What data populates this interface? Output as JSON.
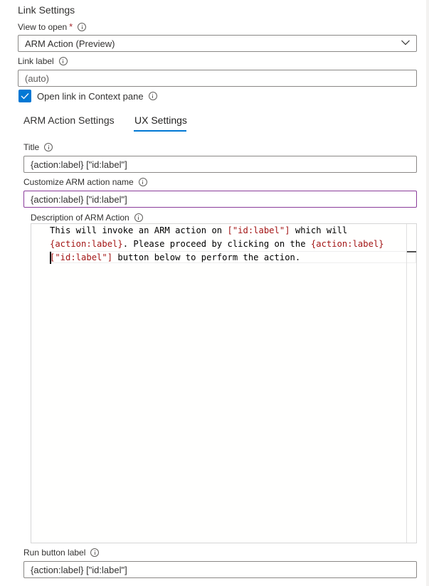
{
  "section_title": "Link Settings",
  "view_to_open": {
    "label": "View to open",
    "required_mark": "*",
    "value": "ARM Action (Preview)"
  },
  "link_label": {
    "label": "Link label",
    "placeholder": "(auto)"
  },
  "open_in_context": {
    "label": "Open link in Context pane",
    "checked": true
  },
  "tabs": [
    {
      "label": "ARM Action Settings",
      "active": false
    },
    {
      "label": "UX Settings",
      "active": true
    }
  ],
  "title_field": {
    "label": "Title",
    "value": "{action:label} [\"id:label\"]"
  },
  "arm_action_name": {
    "label": "Customize ARM action name",
    "value": "{action:label} [\"id:label\"]"
  },
  "description": {
    "label": "Description of ARM Action",
    "lines": [
      [
        {
          "t": "This will invoke an ARM action on ",
          "k": "text"
        },
        {
          "t": "[\"id:label\"]",
          "k": "token"
        },
        {
          "t": " which will",
          "k": "text"
        }
      ],
      [
        {
          "t": "{action:label}",
          "k": "token"
        },
        {
          "t": ". Please proceed by clicking on the ",
          "k": "text"
        },
        {
          "t": "{action:label}",
          "k": "token"
        }
      ],
      [
        {
          "t": "[\"id:label\"]",
          "k": "token"
        },
        {
          "t": " button below to perform the action.",
          "k": "text"
        }
      ]
    ]
  },
  "run_button_label": {
    "label": "Run button label",
    "value": "{action:label} [\"id:label\"]"
  },
  "colors": {
    "accent": "#0078d4",
    "focus_border": "#8a3b9a",
    "token": "#a31515",
    "required": "#a4262c"
  }
}
